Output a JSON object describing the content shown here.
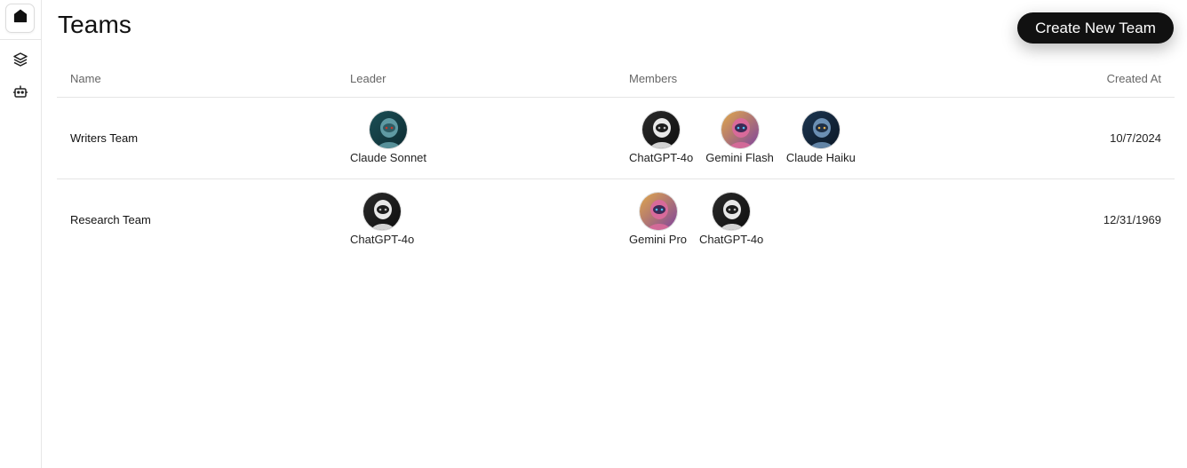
{
  "sidebar": {
    "items": [
      {
        "icon": "home-icon"
      },
      {
        "icon": "layers-icon"
      },
      {
        "icon": "bot-icon"
      }
    ]
  },
  "header": {
    "title": "Teams",
    "create_button_label": "Create New Team"
  },
  "table": {
    "columns": [
      "Name",
      "Leader",
      "Members",
      "Created At"
    ],
    "rows": [
      {
        "name": "Writers Team",
        "leader": {
          "name": "Claude Sonnet",
          "avatar": "robot-teal"
        },
        "members": [
          {
            "name": "ChatGPT-4o",
            "avatar": "robot-white"
          },
          {
            "name": "Gemini Flash",
            "avatar": "robot-colorful"
          },
          {
            "name": "Claude Haiku",
            "avatar": "robot-blue"
          }
        ],
        "created_at": "10/7/2024"
      },
      {
        "name": "Research Team",
        "leader": {
          "name": "ChatGPT-4o",
          "avatar": "robot-white"
        },
        "members": [
          {
            "name": "Gemini Pro",
            "avatar": "robot-colorful"
          },
          {
            "name": "ChatGPT-4o",
            "avatar": "robot-white"
          }
        ],
        "created_at": "12/31/1969"
      }
    ]
  }
}
